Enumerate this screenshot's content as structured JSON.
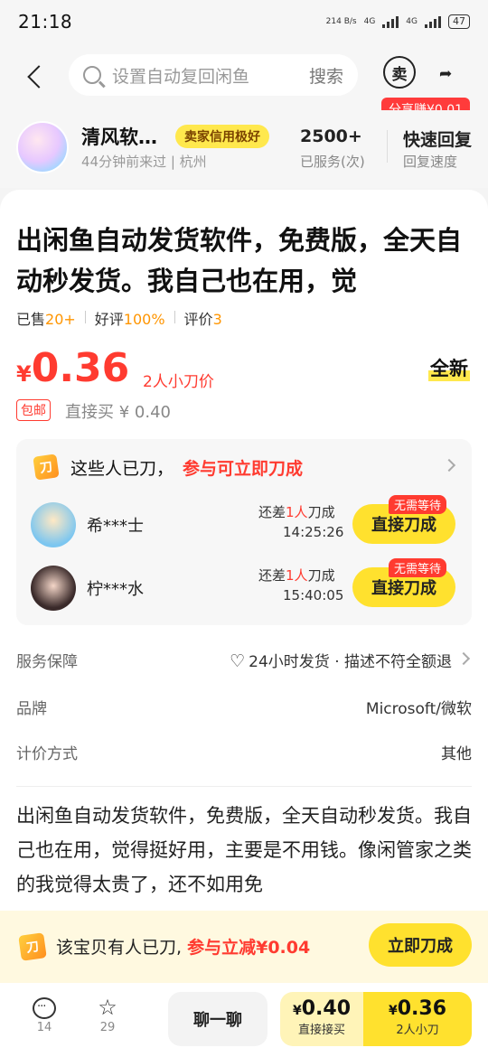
{
  "status_bar": {
    "time": "21:18",
    "net_speed": "214 B/s",
    "net1": "4G",
    "net2": "4G",
    "battery": "47"
  },
  "header": {
    "search_placeholder": "设置自动复回闲鱼",
    "search_button": "搜索",
    "sell_icon_label": "卖",
    "share_badge": "分享赚¥0.01"
  },
  "seller": {
    "name": "清风软…",
    "credit_tag": "卖家信用极好",
    "last_seen": "44分钟前来过 | 杭州",
    "served_count": "2500+",
    "served_label": "已服务(次)",
    "reply_speed": "快速回复",
    "reply_label": "回复速度"
  },
  "product": {
    "title": "出闲鱼自动发货软件，免费版，全天自动秒发货。我自己也在用，觉",
    "sold_label": "已售",
    "sold_value": "20+",
    "good_label": "好评",
    "good_value": "100%",
    "review_label": "评价",
    "review_value": "3",
    "currency": "¥",
    "price": "0.36",
    "price_note": "2人小刀价",
    "condition": "全新",
    "free_shipping": "包邮",
    "direct_price": "直接买 ¥ 0.40"
  },
  "cut": {
    "icon_label": "刀",
    "title": "这些人已刀，",
    "title_action": "参与可立即刀成",
    "rows": [
      {
        "name": "希***士",
        "need_prefix": "还差",
        "need_num": "1人",
        "need_suffix": "刀成",
        "time": "14:25:26",
        "button": "直接刀成",
        "badge": "无需等待"
      },
      {
        "name": "柠***水",
        "need_prefix": "还差",
        "need_num": "1人",
        "need_suffix": "刀成",
        "time": "15:40:05",
        "button": "直接刀成",
        "badge": "无需等待"
      }
    ]
  },
  "info": {
    "service_label": "服务保障",
    "service_value": "24小时发货 · 描述不符全额退",
    "brand_label": "品牌",
    "brand_value": "Microsoft/微软",
    "pricing_label": "计价方式",
    "pricing_value": "其他"
  },
  "description": "出闲鱼自动发货软件，免费版，全天自动秒发货。我自己也在用，觉得挺好用，主要是不用钱。像闲管家之类的我觉得太贵了，还不如用免",
  "banner": {
    "icon_label": "刀",
    "text": "该宝贝有人已刀,",
    "text_red": "参与立减¥0.04",
    "button": "立即刀成"
  },
  "bottom": {
    "comments": "14",
    "favorites": "29",
    "chat_button": "聊一聊",
    "buy_price": "0.40",
    "buy_label": "直接接买",
    "cut_price": "0.36",
    "cut_label": "2人小刀",
    "currency": "¥"
  },
  "colors": {
    "accent_yellow": "#ffe12e",
    "price_red": "#ff3b30",
    "sold_orange": "#ff9500"
  }
}
